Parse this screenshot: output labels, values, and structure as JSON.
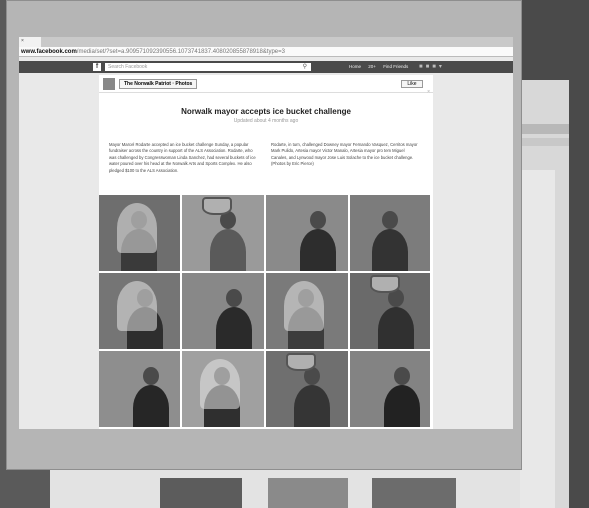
{
  "browser": {
    "tab_label": "",
    "url_host": "www.facebook.com",
    "url_path": "/media/set/?set=a.909571092390556.1073741837.408020855878918&type=3"
  },
  "fb": {
    "search_placeholder": "Search Facebook",
    "nav_items": [
      "Home",
      "20+",
      "Find Friends"
    ]
  },
  "page": {
    "name": "The Norwalk Patriot · Photos",
    "like_label": "Like",
    "album_title": "Norwalk mayor accepts ice bucket challenge",
    "album_updated": "Updated about 4 months ago"
  },
  "description": {
    "left": "Mayor Marcel Rodarte accepted an ice bucket challenge Sunday, a popular fundraiser across the country in support of the ALS Association. Rodarte, who was challenged by Congresswoman Linda Sanchez, had several buckets of ice water poured over his head at the Norwalk Arts and Sports Complex. He also pledged $100 to the ALS Association.",
    "right": "Rodarte, in turn, challenged Downey mayor Fernando Vasquez, Cerritos mayor Mark Pulido, Artesia mayor Victor Manalo, Artesia mayor pro tem Miguel Canales, and Lynwood mayor Jose Luis Solache to the ice bucket challenge. (Photos by Eric Pierce)"
  },
  "photos": [
    {
      "bg": "#6e6e6e",
      "fig": "#3a3a3a",
      "splash": true
    },
    {
      "bg": "#9a9a9a",
      "fig": "#5a5a5a",
      "bucket": true
    },
    {
      "bg": "#8a8a8a",
      "fig": "#2d2d2d"
    },
    {
      "bg": "#7c7c7c",
      "fig": "#333333"
    },
    {
      "bg": "#757575",
      "fig": "#2e2e2e",
      "splash": true
    },
    {
      "bg": "#888888",
      "fig": "#2a2a2a"
    },
    {
      "bg": "#7a7a7a",
      "fig": "#3c3c3c",
      "splash": true
    },
    {
      "bg": "#6a6a6a",
      "fig": "#303030",
      "bucket": true
    },
    {
      "bg": "#8e8e8e",
      "fig": "#262626"
    },
    {
      "bg": "#a0a0a0",
      "fig": "#2f2f2f",
      "splash": true
    },
    {
      "bg": "#6f6f6f",
      "fig": "#353535",
      "bucket": true
    },
    {
      "bg": "#838383",
      "fig": "#222222"
    }
  ]
}
